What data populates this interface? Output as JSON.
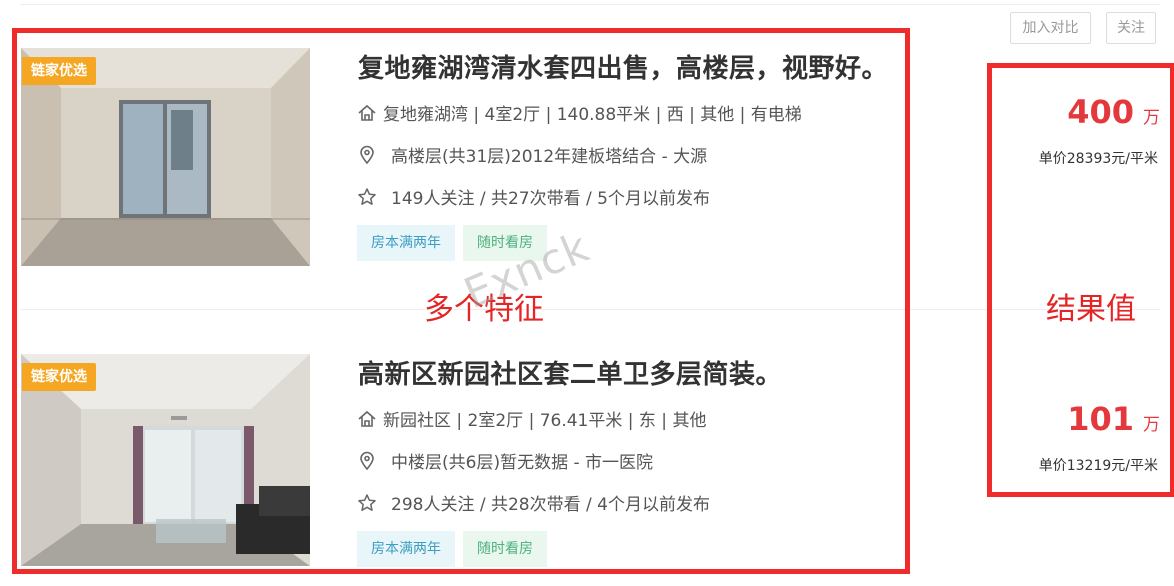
{
  "header": {
    "compare_label": "加入对比",
    "follow_label": "关注"
  },
  "listings": [
    {
      "badge": "链家优选",
      "title": "复地雍湖湾清水套四出售，高楼层，视野好。",
      "house_info": "复地雍湖湾 | 4室2厅 | 140.88平米 | 西 | 其他 | 有电梯",
      "position_info": "高楼层(共31层)2012年建板塔结合 - 大源",
      "follow_info": "149人关注 / 共27次带看 / 5个月以前发布",
      "tags": [
        "房本满两年",
        "随时看房"
      ],
      "total_price": "400",
      "total_unit": "万",
      "unit_price": "单价28393元/平米"
    },
    {
      "badge": "链家优选",
      "title": "高新区新园社区套二单卫多层简装。",
      "house_info": "新园社区 | 2室2厅 | 76.41平米 | 东 | 其他",
      "position_info": "中楼层(共6层)暂无数据 - 市一医院",
      "follow_info": "298人关注 / 共28次带看 / 4个月以前发布",
      "tags": [
        "房本满两年",
        "随时看房"
      ],
      "total_price": "101",
      "total_unit": "万",
      "unit_price": "单价13219元/平米"
    }
  ],
  "annotations": {
    "features": "多个特征",
    "result": "结果值"
  },
  "watermark": "Exnck",
  "colors": {
    "accent_red": "#e4393c",
    "annotation_red": "#ef2b2b",
    "badge_orange": "#f5a623"
  },
  "icons": [
    "house-icon",
    "location-pin-icon",
    "star-icon"
  ]
}
